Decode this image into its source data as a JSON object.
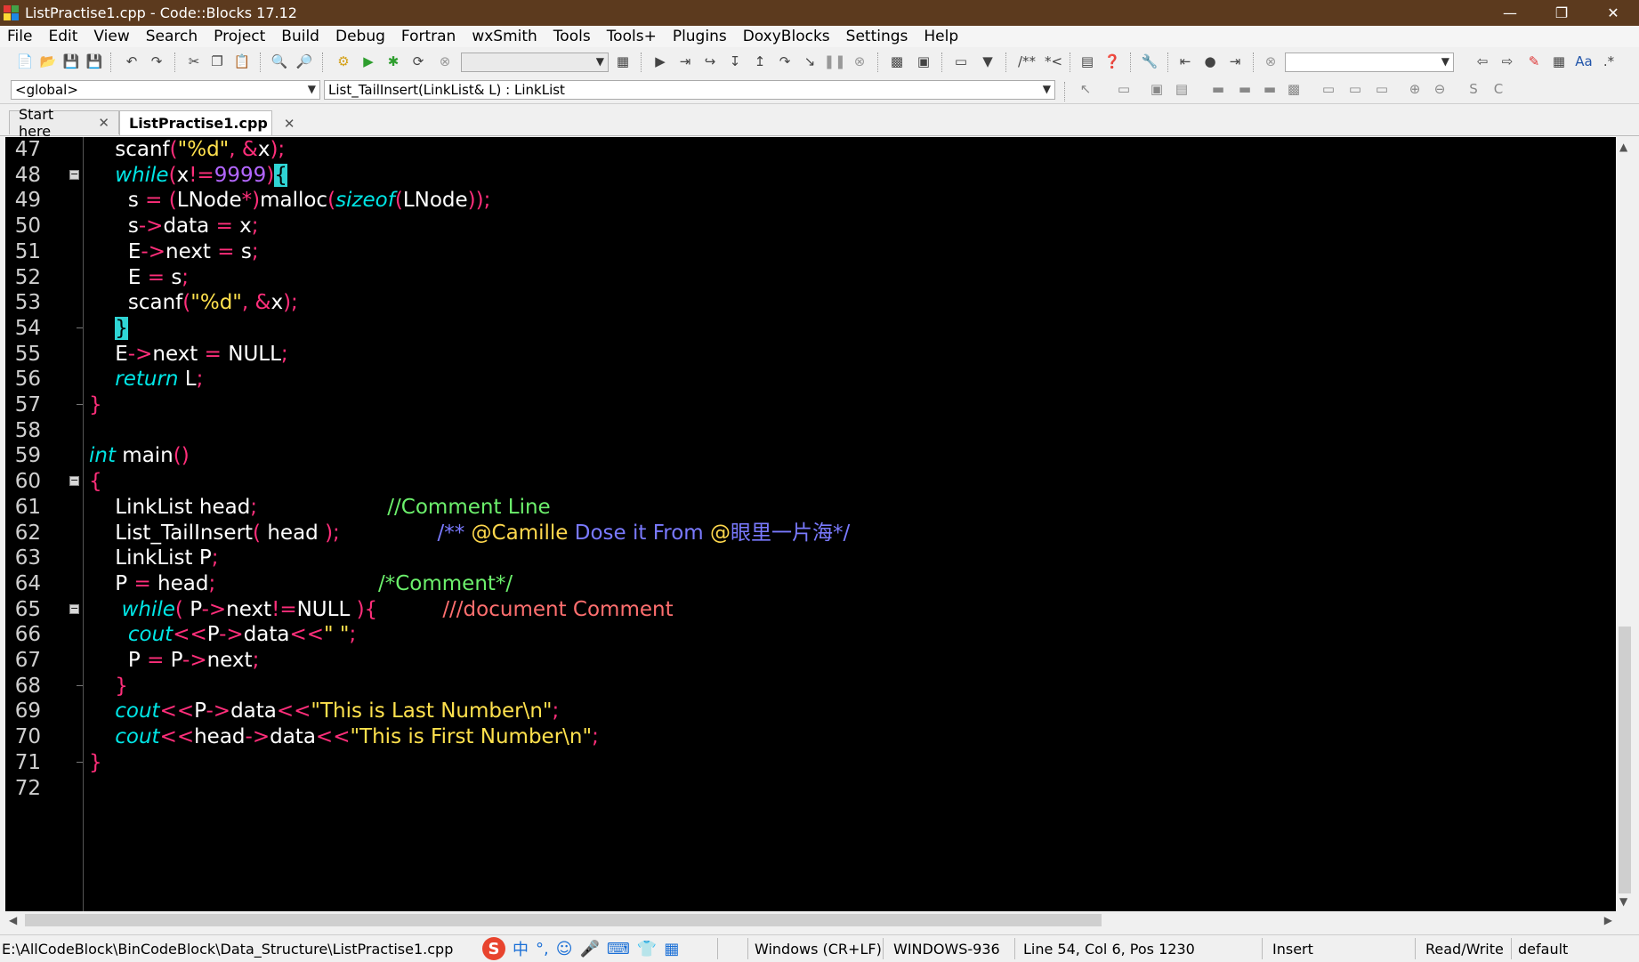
{
  "window": {
    "title": "ListPractise1.cpp - Code::Blocks 17.12"
  },
  "menu": [
    "File",
    "Edit",
    "View",
    "Search",
    "Project",
    "Build",
    "Debug",
    "Fortran",
    "wxSmith",
    "Tools",
    "Tools+",
    "Plugins",
    "DoxyBlocks",
    "Settings",
    "Help"
  ],
  "scope_combo": "<global>",
  "function_combo": "List_TailInsert(LinkList& L) : LinkList",
  "tabs": [
    {
      "label": "Start here",
      "active": false
    },
    {
      "label": "ListPractise1.cpp",
      "active": true
    }
  ],
  "code": [
    {
      "n": "47",
      "fold": "",
      "tokens": [
        [
          "    ",
          "id"
        ],
        [
          "scanf",
          "id"
        ],
        [
          "(",
          "op"
        ],
        [
          "\"%d\"",
          "str"
        ],
        [
          ", ",
          "op"
        ],
        [
          "&",
          "op"
        ],
        [
          "x",
          "id"
        ],
        [
          ");",
          "op"
        ]
      ]
    },
    {
      "n": "48",
      "fold": "box",
      "tokens": [
        [
          "    ",
          "id"
        ],
        [
          "while",
          "kw"
        ],
        [
          "(",
          "op"
        ],
        [
          "x",
          "id"
        ],
        [
          "!=",
          "op"
        ],
        [
          "9999",
          "num"
        ],
        [
          ")",
          "op"
        ],
        [
          "{",
          "caret"
        ]
      ]
    },
    {
      "n": "49",
      "fold": "",
      "tokens": [
        [
          "      ",
          "id"
        ],
        [
          "s ",
          "id"
        ],
        [
          "= ",
          "op"
        ],
        [
          "(",
          "op"
        ],
        [
          "LNode",
          "id"
        ],
        [
          "*)",
          "op"
        ],
        [
          "malloc",
          "id"
        ],
        [
          "(",
          "op"
        ],
        [
          "sizeof",
          "kw"
        ],
        [
          "(",
          "op"
        ],
        [
          "LNode",
          "id"
        ],
        [
          "));",
          "op"
        ]
      ]
    },
    {
      "n": "50",
      "fold": "",
      "tokens": [
        [
          "      ",
          "id"
        ],
        [
          "s",
          "id"
        ],
        [
          "->",
          "op"
        ],
        [
          "data ",
          "id"
        ],
        [
          "= ",
          "op"
        ],
        [
          "x",
          "id"
        ],
        [
          ";",
          "op"
        ]
      ]
    },
    {
      "n": "51",
      "fold": "",
      "tokens": [
        [
          "      ",
          "id"
        ],
        [
          "E",
          "id"
        ],
        [
          "->",
          "op"
        ],
        [
          "next ",
          "id"
        ],
        [
          "= ",
          "op"
        ],
        [
          "s",
          "id"
        ],
        [
          ";",
          "op"
        ]
      ]
    },
    {
      "n": "52",
      "fold": "",
      "tokens": [
        [
          "      ",
          "id"
        ],
        [
          "E ",
          "id"
        ],
        [
          "= ",
          "op"
        ],
        [
          "s",
          "id"
        ],
        [
          ";",
          "op"
        ]
      ]
    },
    {
      "n": "53",
      "fold": "",
      "tokens": [
        [
          "      ",
          "id"
        ],
        [
          "scanf",
          "id"
        ],
        [
          "(",
          "op"
        ],
        [
          "\"%d\"",
          "str"
        ],
        [
          ", ",
          "op"
        ],
        [
          "&",
          "op"
        ],
        [
          "x",
          "id"
        ],
        [
          ");",
          "op"
        ]
      ]
    },
    {
      "n": "54",
      "fold": "tick",
      "tokens": [
        [
          "    ",
          "id"
        ],
        [
          "}",
          "caret"
        ]
      ]
    },
    {
      "n": "55",
      "fold": "",
      "tokens": [
        [
          "    ",
          "id"
        ],
        [
          "E",
          "id"
        ],
        [
          "->",
          "op"
        ],
        [
          "next ",
          "id"
        ],
        [
          "= ",
          "op"
        ],
        [
          "NULL",
          "id"
        ],
        [
          ";",
          "op"
        ]
      ]
    },
    {
      "n": "56",
      "fold": "",
      "tokens": [
        [
          "    ",
          "id"
        ],
        [
          "return ",
          "kw"
        ],
        [
          "L",
          "id"
        ],
        [
          ";",
          "op"
        ]
      ]
    },
    {
      "n": "57",
      "fold": "tick",
      "tokens": [
        [
          "}",
          "op"
        ]
      ]
    },
    {
      "n": "58",
      "fold": "",
      "tokens": []
    },
    {
      "n": "59",
      "fold": "",
      "tokens": [
        [
          "int ",
          "kw"
        ],
        [
          "main",
          "id"
        ],
        [
          "()",
          "op"
        ]
      ]
    },
    {
      "n": "60",
      "fold": "box",
      "tokens": [
        [
          "{",
          "op"
        ]
      ]
    },
    {
      "n": "61",
      "fold": "",
      "tokens": [
        [
          "    ",
          "id"
        ],
        [
          "LinkList head",
          "id"
        ],
        [
          ";",
          "op"
        ],
        [
          "                    ",
          "id"
        ],
        [
          "//Comment Line",
          "cm"
        ]
      ]
    },
    {
      "n": "62",
      "fold": "",
      "tokens": [
        [
          "    ",
          "id"
        ],
        [
          "List_TailInsert",
          "id"
        ],
        [
          "( ",
          "op"
        ],
        [
          "head ",
          "id"
        ],
        [
          ");",
          "op"
        ],
        [
          "               ",
          "id"
        ],
        [
          "/** ",
          "dcm"
        ],
        [
          "@Camille ",
          "dtag"
        ],
        [
          "Dose it From ",
          "dcm"
        ],
        [
          "@",
          "dtag"
        ],
        [
          "眼里一片海*/",
          "dcm"
        ]
      ]
    },
    {
      "n": "63",
      "fold": "",
      "tokens": [
        [
          "    ",
          "id"
        ],
        [
          "LinkList P",
          "id"
        ],
        [
          ";",
          "op"
        ]
      ]
    },
    {
      "n": "64",
      "fold": "",
      "tokens": [
        [
          "    ",
          "id"
        ],
        [
          "P ",
          "id"
        ],
        [
          "= ",
          "op"
        ],
        [
          "head",
          "id"
        ],
        [
          ";",
          "op"
        ],
        [
          "                         ",
          "id"
        ],
        [
          "/*Comment*/",
          "cm"
        ]
      ]
    },
    {
      "n": "65",
      "fold": "box",
      "tokens": [
        [
          "     ",
          "id"
        ],
        [
          "while",
          "kw"
        ],
        [
          "( ",
          "op"
        ],
        [
          "P",
          "id"
        ],
        [
          "->",
          "op"
        ],
        [
          "next",
          "id"
        ],
        [
          "!=",
          "op"
        ],
        [
          "NULL ",
          "id"
        ],
        [
          "){",
          "op"
        ],
        [
          "          ",
          "id"
        ],
        [
          "///document Comment",
          "dcm3"
        ]
      ]
    },
    {
      "n": "66",
      "fold": "",
      "tokens": [
        [
          "      ",
          "id"
        ],
        [
          "cout",
          "kw"
        ],
        [
          "<<",
          "op"
        ],
        [
          "P",
          "id"
        ],
        [
          "->",
          "op"
        ],
        [
          "data",
          "id"
        ],
        [
          "<<",
          "op"
        ],
        [
          "\" \"",
          "str"
        ],
        [
          ";",
          "op"
        ]
      ]
    },
    {
      "n": "67",
      "fold": "",
      "tokens": [
        [
          "      ",
          "id"
        ],
        [
          "P ",
          "id"
        ],
        [
          "= ",
          "op"
        ],
        [
          "P",
          "id"
        ],
        [
          "->",
          "op"
        ],
        [
          "next",
          "id"
        ],
        [
          ";",
          "op"
        ]
      ]
    },
    {
      "n": "68",
      "fold": "tick",
      "tokens": [
        [
          "    ",
          "id"
        ],
        [
          "}",
          "op"
        ]
      ]
    },
    {
      "n": "69",
      "fold": "",
      "tokens": [
        [
          "    ",
          "id"
        ],
        [
          "cout",
          "kw"
        ],
        [
          "<<",
          "op"
        ],
        [
          "P",
          "id"
        ],
        [
          "->",
          "op"
        ],
        [
          "data",
          "id"
        ],
        [
          "<<",
          "op"
        ],
        [
          "\"This is Last Number\\n\"",
          "str"
        ],
        [
          ";",
          "op"
        ]
      ]
    },
    {
      "n": "70",
      "fold": "",
      "tokens": [
        [
          "    ",
          "id"
        ],
        [
          "cout",
          "kw"
        ],
        [
          "<<",
          "op"
        ],
        [
          "head",
          "id"
        ],
        [
          "->",
          "op"
        ],
        [
          "data",
          "id"
        ],
        [
          "<<",
          "op"
        ],
        [
          "\"This is First Number\\n\"",
          "str"
        ],
        [
          ";",
          "op"
        ]
      ]
    },
    {
      "n": "71",
      "fold": "tick",
      "tokens": [
        [
          "}",
          "op"
        ]
      ]
    },
    {
      "n": "72",
      "fold": "",
      "tokens": []
    }
  ],
  "status": {
    "path": "E:\\AllCodeBlock\\BinCodeBlock\\Data_Structure\\ListPractise1.cpp",
    "eol": "Windows (CR+LF)",
    "encoding": "WINDOWS-936",
    "position": "Line 54, Col 6, Pos 1230",
    "mode": "Insert",
    "access": "Read/Write",
    "profile": "default"
  },
  "ime_glyphs": [
    "S",
    "中",
    "°,",
    "☺",
    "🎤",
    "⌨",
    "👕",
    "▦"
  ],
  "colors": {
    "titlebar": "#5c3a1e",
    "editor_bg": "#000000",
    "keyword": "#00e5e5",
    "operator": "#ff2e7a",
    "number": "#b366ff",
    "string": "#ffe14d",
    "comment": "#6cf06c"
  }
}
